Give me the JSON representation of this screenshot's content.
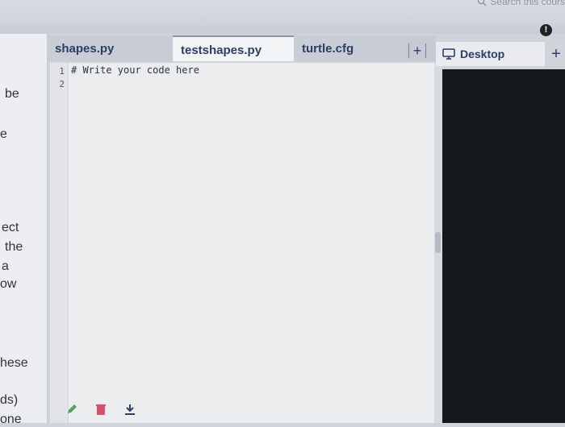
{
  "header": {
    "search_placeholder": "Search this cours"
  },
  "tabs": [
    {
      "label": "shapes.py",
      "active": false
    },
    {
      "label": "testshapes.py",
      "active": true
    },
    {
      "label": "turtle.cfg",
      "active": false
    }
  ],
  "add_tab_label": "+",
  "left_panel": {
    "fragments": [
      "be",
      "e",
      "ect",
      "the",
      "a",
      "ow",
      "hese",
      "ds)",
      "one"
    ]
  },
  "editor": {
    "line_numbers": [
      "1",
      "2"
    ],
    "lines": [
      "# Write your code here",
      ""
    ]
  },
  "right_panel": {
    "tab_label": "Desktop",
    "add_label": "+"
  },
  "icons": [
    "search-icon",
    "info-icon",
    "monitor-icon",
    "pencil-icon",
    "trash-icon",
    "download-icon"
  ],
  "colors": {
    "accent": "#2c3e66",
    "terminal_bg": "#15181c",
    "tool_green": "#4aa56b",
    "tool_red": "#d9506b",
    "tool_navy": "#2c3e66"
  }
}
